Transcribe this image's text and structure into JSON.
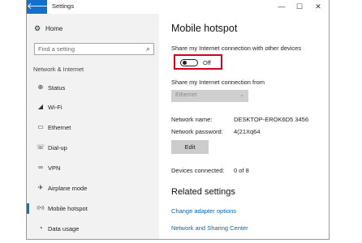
{
  "window": {
    "title": "Settings",
    "back_glyph": "🡐",
    "minimize": "—",
    "maximize": "☐",
    "close": "✕"
  },
  "sidebar": {
    "home_label": "Home",
    "search_placeholder": "Find a setting",
    "section_label": "Network & Internet",
    "items": [
      {
        "label": "Status",
        "icon": "globe-icon",
        "glyph": "⊕"
      },
      {
        "label": "Wi-Fi",
        "icon": "wifi-icon",
        "glyph": "◢"
      },
      {
        "label": "Ethernet",
        "icon": "ethernet-icon",
        "glyph": "▭"
      },
      {
        "label": "Dial-up",
        "icon": "dialup-icon",
        "glyph": "☏"
      },
      {
        "label": "VPN",
        "icon": "vpn-icon",
        "glyph": "∞"
      },
      {
        "label": "Airplane mode",
        "icon": "airplane-icon",
        "glyph": "✈"
      },
      {
        "label": "Mobile hotspot",
        "icon": "hotspot-icon",
        "glyph": "((•))"
      },
      {
        "label": "Data usage",
        "icon": "data-usage-icon",
        "glyph": "◔"
      }
    ]
  },
  "main": {
    "title": "Mobile hotspot",
    "share_label": "Share my Internet connection with other devices",
    "toggle_state": "Off",
    "share_from_label": "Share my Internet connection from",
    "share_from_value": "Ethernet",
    "network_name_label": "Network name:",
    "network_name_value": "DESKTOP-EROK6D5 3456",
    "network_password_label": "Network password:",
    "network_password_value": "4(21Xq64",
    "edit_label": "Edit",
    "devices_label": "Devices connected:",
    "devices_value": "0 of 8",
    "related_title": "Related settings",
    "link1": "Change adapter options",
    "link2": "Network and Sharing Center"
  },
  "colors": {
    "accent": "#1570c9",
    "highlight_box": "#d0021b",
    "link": "#0066b4"
  }
}
